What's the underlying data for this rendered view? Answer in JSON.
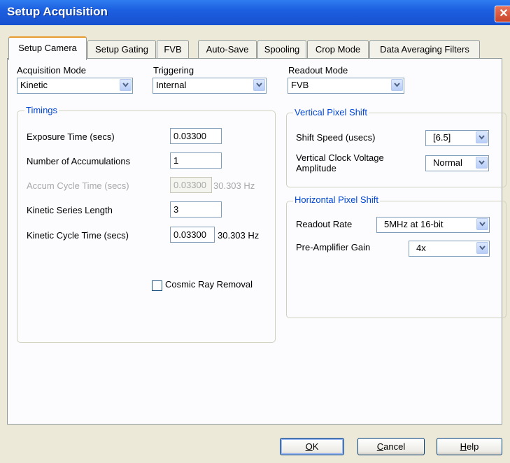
{
  "window": {
    "title": "Setup Acquisition",
    "close_glyph": "✕"
  },
  "tabs": [
    {
      "label": "Setup Camera",
      "active": true
    },
    {
      "label": "Setup Gating",
      "active": false
    },
    {
      "label": "FVB",
      "active": false
    },
    {
      "label": "Auto-Save",
      "active": false
    },
    {
      "label": "Spooling",
      "active": false
    },
    {
      "label": "Crop Mode",
      "active": false
    },
    {
      "label": "Data Averaging Filters",
      "active": false
    }
  ],
  "acquisition_mode": {
    "label": "Acquisition Mode",
    "value": "Kinetic"
  },
  "triggering": {
    "label": "Triggering",
    "value": "Internal"
  },
  "readout_mode": {
    "label": "Readout Mode",
    "value": "FVB"
  },
  "timings": {
    "legend": "Timings",
    "exposure_time": {
      "label": "Exposure Time (secs)",
      "value": "0.03300"
    },
    "accumulations": {
      "label": "Number of Accumulations",
      "value": "1"
    },
    "accum_cycle": {
      "label": "Accum Cycle Time (secs)",
      "value": "0.03300",
      "freq": "30.303 Hz"
    },
    "series_length": {
      "label": "Kinetic Series Length",
      "value": "3"
    },
    "kinetic_cycle": {
      "label": "Kinetic Cycle Time (secs)",
      "value": "0.03300",
      "freq": "30.303 Hz"
    },
    "cosmic_ray": {
      "label": "Cosmic Ray Removal",
      "checked": false
    }
  },
  "vertical_shift": {
    "legend": "Vertical Pixel Shift",
    "shift_speed": {
      "label": "Shift Speed (usecs)",
      "value": "[6.5]"
    },
    "clock_voltage": {
      "label_line1": "Vertical Clock Voltage",
      "label_line2": "Amplitude",
      "value": "Normal"
    }
  },
  "horizontal_shift": {
    "legend": "Horizontal Pixel Shift",
    "readout_rate": {
      "label": "Readout Rate",
      "value": "5MHz at 16-bit"
    },
    "preamp_gain": {
      "label": "Pre-Amplifier Gain",
      "value": "4x"
    }
  },
  "buttons": {
    "ok": {
      "label": "OK",
      "mnemonic": "O",
      "rest": "K"
    },
    "cancel": {
      "label": "Cancel",
      "mnemonic": "C",
      "rest": "ancel"
    },
    "help": {
      "label": "Help",
      "mnemonic": "H",
      "rest": "elp"
    }
  },
  "colors": {
    "title_bar": "#1c5fe0",
    "group_legend": "#0046d5",
    "active_tab_accent": "#e69b2f"
  }
}
